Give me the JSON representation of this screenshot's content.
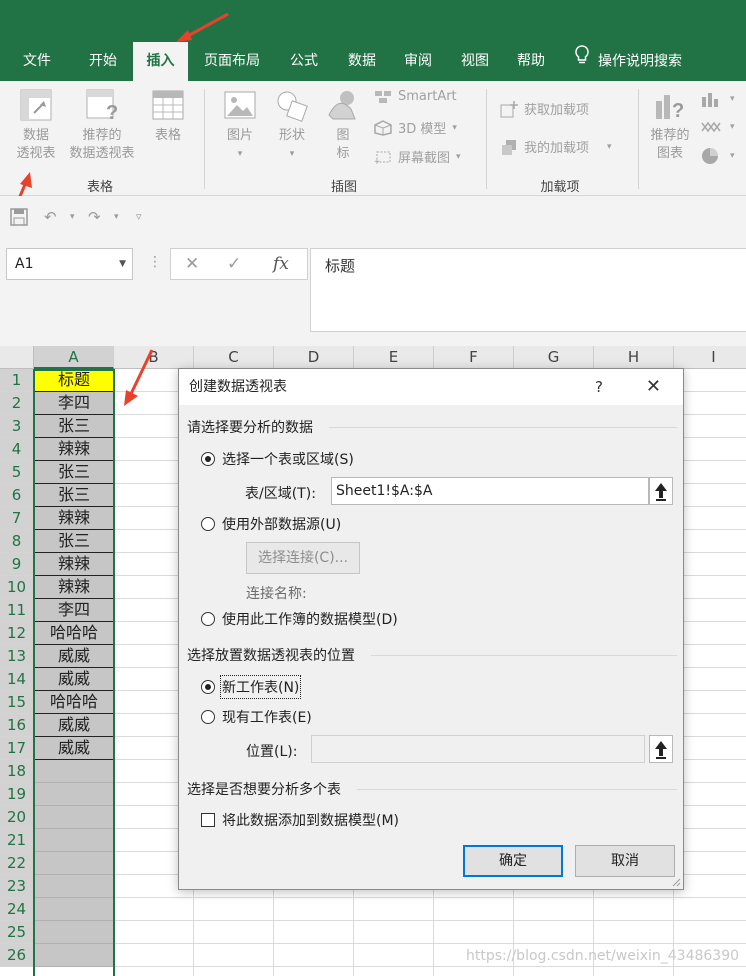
{
  "ribbon_tabs": [
    "文件",
    "开始",
    "插入",
    "页面布局",
    "公式",
    "数据",
    "审阅",
    "视图",
    "帮助"
  ],
  "tell_me": "操作说明搜索",
  "ribbon": {
    "pivot_line1": "数据",
    "pivot_line2": "透视表",
    "recommended_line1": "推荐的",
    "recommended_line2": "数据透视表",
    "table": "表格",
    "group_tables": "表格",
    "pictures": "图片",
    "shapes": "形状",
    "icons_line1": "图",
    "icons_line2": "标",
    "smartart": "SmartArt",
    "model3d": "3D 模型",
    "screenshot": "屏幕截图",
    "group_illustrations": "插图",
    "get_addins": "获取加载项",
    "my_addins": "我的加载项",
    "group_addins": "加载项",
    "rec_charts_line1": "推荐的",
    "rec_charts_line2": "图表"
  },
  "formula_bar": {
    "name_box": "A1",
    "formula": "标题"
  },
  "columns": [
    "A",
    "B",
    "C",
    "D",
    "E",
    "F",
    "G",
    "H",
    "I"
  ],
  "rows": [
    "1",
    "2",
    "3",
    "4",
    "5",
    "6",
    "7",
    "8",
    "9",
    "10",
    "11",
    "12",
    "13",
    "14",
    "15",
    "16",
    "17",
    "18",
    "19",
    "20",
    "21",
    "22",
    "23",
    "24",
    "25",
    "26"
  ],
  "column_a": [
    "标题",
    "李四",
    "张三",
    "辣辣",
    "张三",
    "张三",
    "辣辣",
    "张三",
    "辣辣",
    "辣辣",
    "李四",
    "哈哈哈",
    "威威",
    "威威",
    "哈哈哈",
    "威威",
    "威威"
  ],
  "dialog": {
    "title": "创建数据透视表",
    "help": "?",
    "close": "✕",
    "section1": "请选择要分析的数据",
    "opt_table_range": "选择一个表或区域(S)",
    "table_range_label": "表/区域(T):",
    "table_range_value": "Sheet1!$A:$A",
    "opt_external": "使用外部数据源(U)",
    "choose_connection": "选择连接(C)...",
    "connection_name_label": "连接名称:",
    "opt_data_model": "使用此工作簿的数据模型(D)",
    "section2": "选择放置数据透视表的位置",
    "opt_new_sheet": "新工作表(N)",
    "opt_existing_sheet": "现有工作表(E)",
    "location_label": "位置(L):",
    "location_value": "",
    "section3": "选择是否想要分析多个表",
    "add_to_model": "将此数据添加到数据模型(M)",
    "ok": "确定",
    "cancel": "取消"
  },
  "watermark": "https://blog.csdn.net/weixin_43486390",
  "colors": {
    "excel_green": "#217346",
    "header_yellow": "#ffff00",
    "arrow_red": "#e8412c",
    "selection_gray": "#c6c6c6"
  }
}
